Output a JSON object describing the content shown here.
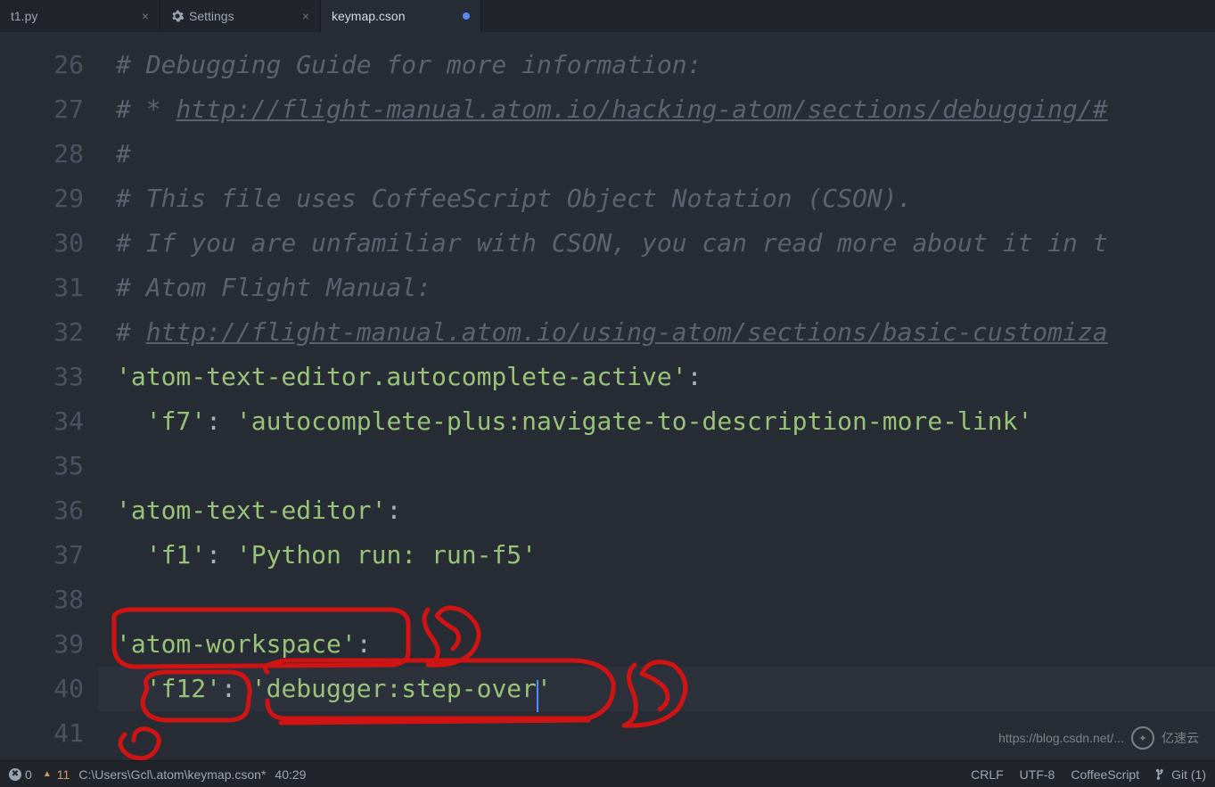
{
  "tabs": [
    {
      "label": "t1.py",
      "active": false,
      "icon": null,
      "dirty": false,
      "closable": true
    },
    {
      "label": "Settings",
      "active": false,
      "icon": "gear",
      "dirty": false,
      "closable": true
    },
    {
      "label": "keymap.cson",
      "active": true,
      "icon": null,
      "dirty": true,
      "closable": false
    }
  ],
  "editor": {
    "lines": [
      {
        "num": 26,
        "tokens": [
          {
            "t": "comment",
            "v": "# Debugging Guide for more information:"
          }
        ]
      },
      {
        "num": 27,
        "tokens": [
          {
            "t": "comment",
            "v": "# * "
          },
          {
            "t": "link",
            "v": "http://flight-manual.atom.io/hacking-atom/sections/debugging/#"
          }
        ]
      },
      {
        "num": 28,
        "tokens": [
          {
            "t": "comment",
            "v": "#"
          }
        ]
      },
      {
        "num": 29,
        "tokens": [
          {
            "t": "comment",
            "v": "# This file uses CoffeeScript Object Notation (CSON)."
          }
        ]
      },
      {
        "num": 30,
        "tokens": [
          {
            "t": "comment",
            "v": "# If you are unfamiliar with CSON, you can read more about it in t"
          }
        ]
      },
      {
        "num": 31,
        "tokens": [
          {
            "t": "comment",
            "v": "# Atom Flight Manual:"
          }
        ]
      },
      {
        "num": 32,
        "tokens": [
          {
            "t": "comment",
            "v": "# "
          },
          {
            "t": "link",
            "v": "http://flight-manual.atom.io/using-atom/sections/basic-customiza"
          }
        ]
      },
      {
        "num": 33,
        "tokens": [
          {
            "t": "string",
            "v": "'atom-text-editor.autocomplete-active'"
          },
          {
            "t": "punct",
            "v": ":"
          }
        ]
      },
      {
        "num": 34,
        "tokens": [
          {
            "t": "indent",
            "w": 1
          },
          {
            "t": "string",
            "v": "'f7'"
          },
          {
            "t": "punct",
            "v": ": "
          },
          {
            "t": "string",
            "v": "'autocomplete-plus:navigate-to-description-more-link'"
          }
        ]
      },
      {
        "num": 35,
        "tokens": []
      },
      {
        "num": 36,
        "tokens": [
          {
            "t": "string",
            "v": "'atom-text-editor'"
          },
          {
            "t": "punct",
            "v": ":"
          }
        ]
      },
      {
        "num": 37,
        "tokens": [
          {
            "t": "indent",
            "w": 1
          },
          {
            "t": "string",
            "v": "'f1'"
          },
          {
            "t": "punct",
            "v": ": "
          },
          {
            "t": "string",
            "v": "'Python run: run-f5'"
          }
        ]
      },
      {
        "num": 38,
        "tokens": []
      },
      {
        "num": 39,
        "tokens": [
          {
            "t": "string",
            "v": "'atom-workspace'"
          },
          {
            "t": "punct",
            "v": ":"
          }
        ]
      },
      {
        "num": 40,
        "tokens": [
          {
            "t": "indent",
            "w": 1
          },
          {
            "t": "string",
            "v": "'f12'"
          },
          {
            "t": "punct",
            "v": ": "
          },
          {
            "t": "string",
            "v": "'debugger:step-over"
          },
          {
            "t": "cursor"
          },
          {
            "t": "string",
            "v": "'"
          }
        ],
        "cursorLine": true
      },
      {
        "num": 41,
        "tokens": []
      }
    ]
  },
  "status": {
    "errors": "0",
    "warnings": "11",
    "file_path": "C:\\Users\\Gcl\\.atom\\keymap.cson*",
    "cursor_pos": "40:29",
    "line_ending": "CRLF",
    "encoding": "UTF-8",
    "grammar": "CoffeeScript",
    "git_branch": "Git (1)"
  },
  "watermark": {
    "url_text": "https://blog.csdn.net/...",
    "brand": "亿速云"
  },
  "colors": {
    "bg": "#282c34",
    "tabbar": "#21252b",
    "comment": "#5c6370",
    "string": "#98c379",
    "cursor": "#528bff",
    "annot": "#d01414"
  }
}
